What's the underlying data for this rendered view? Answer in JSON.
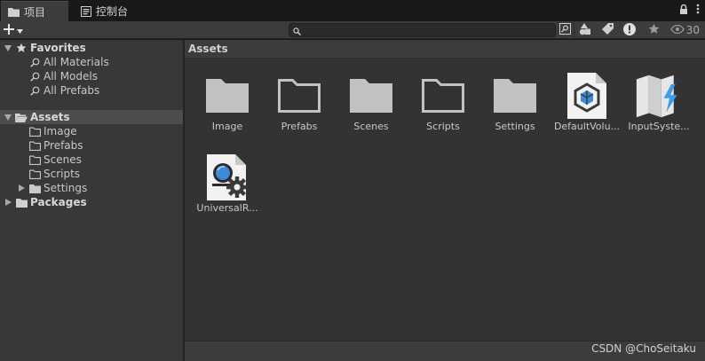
{
  "tabs": [
    {
      "label": "项目",
      "icon": "folder-icon",
      "active": true
    },
    {
      "label": "控制台",
      "icon": "console-icon",
      "active": false
    }
  ],
  "toolbar": {
    "add_label": "+",
    "search_value": "",
    "hidden_count": "30"
  },
  "favorites": {
    "label": "Favorites",
    "items": [
      "All Materials",
      "All Models",
      "All Prefabs"
    ]
  },
  "tree": {
    "assets_label": "Assets",
    "children": [
      "Image",
      "Prefabs",
      "Scenes",
      "Scripts",
      "Settings"
    ],
    "packages_label": "Packages"
  },
  "breadcrumb": "Assets",
  "assets": [
    {
      "name": "Image",
      "type": "folder-filled"
    },
    {
      "name": "Prefabs",
      "type": "folder-outline"
    },
    {
      "name": "Scenes",
      "type": "folder-filled"
    },
    {
      "name": "Scripts",
      "type": "folder-outline"
    },
    {
      "name": "Settings",
      "type": "folder-filled"
    },
    {
      "name": "DefaultVolu...",
      "type": "volume-profile"
    },
    {
      "name": "InputSyste...",
      "type": "input-actions"
    },
    {
      "name": "UniversalR...",
      "type": "render-pipeline-asset"
    }
  ],
  "watermark": "CSDN @ChoSeitaku"
}
